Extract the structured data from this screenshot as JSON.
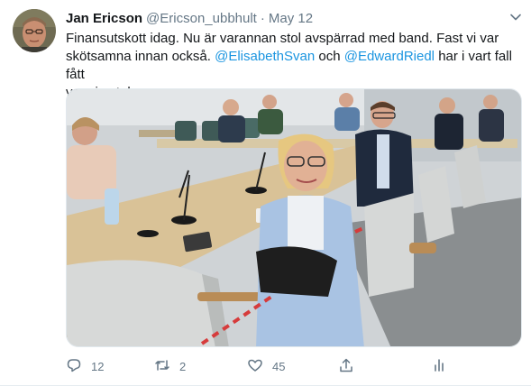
{
  "tweet": {
    "author": {
      "name": "Jan Ericson",
      "handle": "@Ericson_ubbhult",
      "separator": "·",
      "date": "May 12",
      "avatar": "avatar-photo"
    },
    "text": {
      "line1": "Finansutskott idag. Nu är varannan stol avspärrad med band. Fast vi var",
      "line2": "skötsamna innan också.",
      "mention1": "@ElisabethSvan",
      "connector": "och",
      "mention2": "@EdwardRiedl",
      "line2_tail": "har i vart fall fått",
      "line3": "var sin stol."
    },
    "media": {
      "description_icon": "photo-meeting-room"
    },
    "actions": {
      "reply": {
        "icon": "reply-icon",
        "count": "12"
      },
      "retweet": {
        "icon": "retweet-icon",
        "count": "2"
      },
      "like": {
        "icon": "heart-icon",
        "count": "45"
      },
      "share": {
        "icon": "share-icon"
      },
      "analytics": {
        "icon": "analytics-icon"
      }
    }
  },
  "colors": {
    "link": "#1b95e0",
    "muted": "#657786",
    "text": "#14171a"
  }
}
